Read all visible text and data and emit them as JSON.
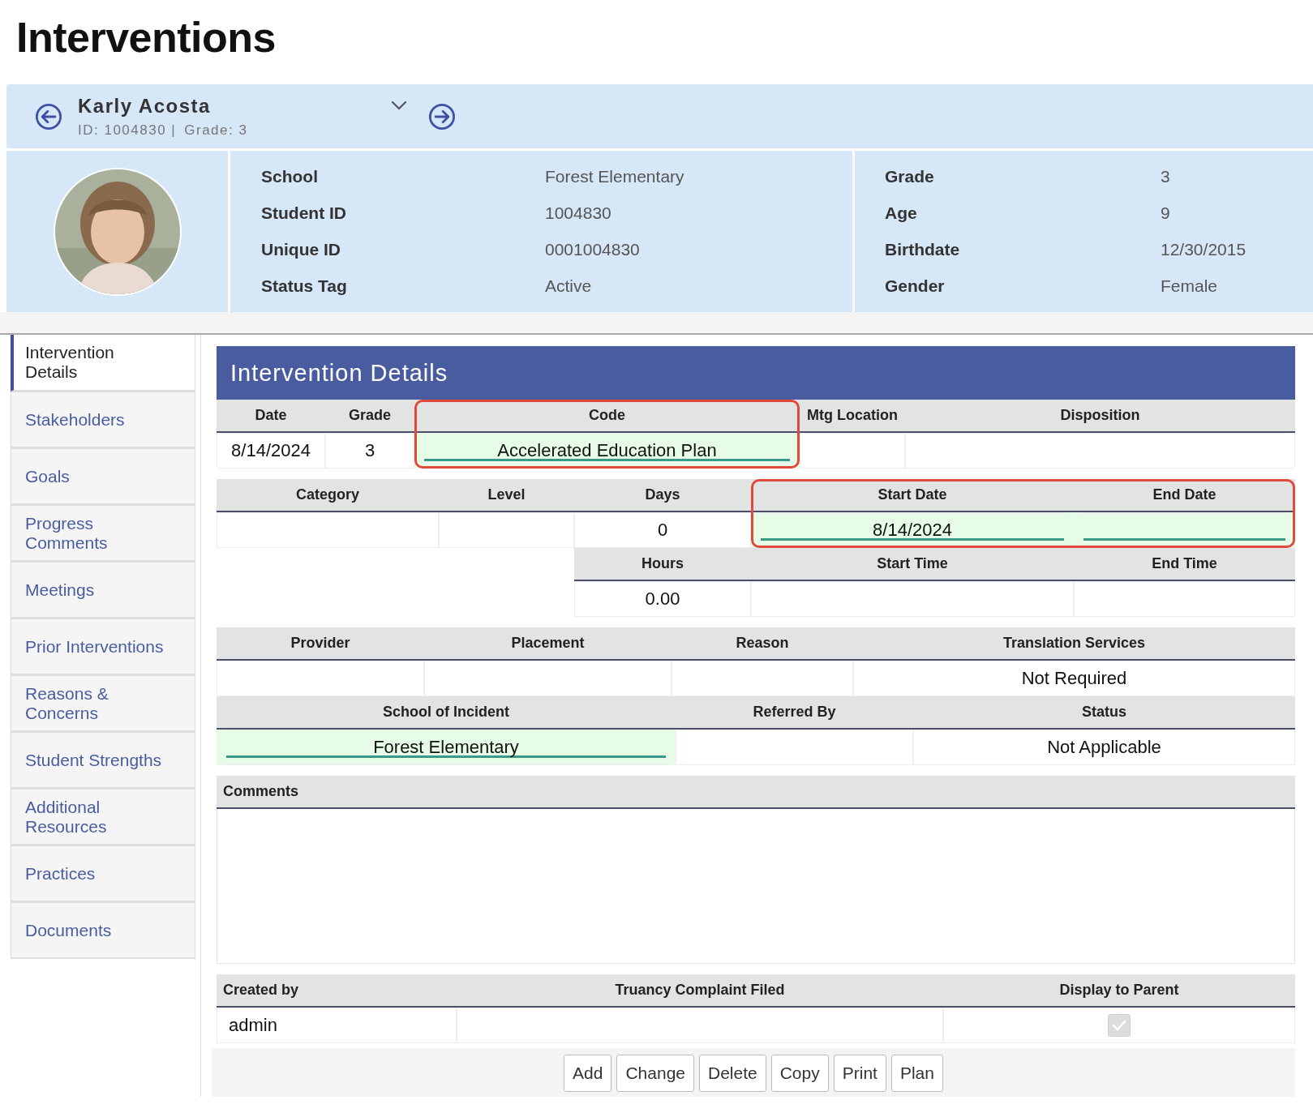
{
  "page_title": "Interventions",
  "student": {
    "name": "Karly Acosta",
    "id_label": "ID: 1004830 |",
    "grade_label": "Grade: 3"
  },
  "profile": {
    "left": [
      {
        "label": "School",
        "value": "Forest Elementary"
      },
      {
        "label": "Student ID",
        "value": "1004830"
      },
      {
        "label": "Unique ID",
        "value": "0001004830"
      },
      {
        "label": "Status Tag",
        "value": "Active"
      }
    ],
    "right": [
      {
        "label": "Grade",
        "value": "3"
      },
      {
        "label": "Age",
        "value": "9"
      },
      {
        "label": "Birthdate",
        "value": "12/30/2015"
      },
      {
        "label": "Gender",
        "value": "Female"
      }
    ]
  },
  "sidebar": {
    "items": [
      {
        "label": "Intervention Details",
        "selected": true
      },
      {
        "label": "Stakeholders",
        "selected": false
      },
      {
        "label": "Goals",
        "selected": false
      },
      {
        "label": "Progress Comments",
        "selected": false
      },
      {
        "label": "Meetings",
        "selected": false
      },
      {
        "label": "Prior Interventions",
        "selected": false
      },
      {
        "label": "Reasons & Concerns",
        "selected": false
      },
      {
        "label": "Student Strengths",
        "selected": false
      },
      {
        "label": "Additional Resources",
        "selected": false
      },
      {
        "label": "Practices",
        "selected": false
      },
      {
        "label": "Documents",
        "selected": false
      }
    ]
  },
  "panel": {
    "title": "Intervention Details",
    "groups": [
      {
        "columns": [
          {
            "label": "Date",
            "value": "8/14/2024",
            "required": false,
            "highlighted": false
          },
          {
            "label": "Grade",
            "value": "3",
            "required": false,
            "highlighted": false
          },
          {
            "label": "Code",
            "value": "Accelerated Education Plan",
            "required": true,
            "highlighted": true
          },
          {
            "label": "Mtg Location",
            "required": false,
            "highlighted": false
          },
          {
            "label": "Disposition",
            "required": false,
            "highlighted": false
          }
        ]
      },
      {
        "columns": [
          {
            "label": "Category",
            "required": false,
            "highlighted": false
          },
          {
            "label": "Level",
            "required": false,
            "highlighted": false
          },
          {
            "label": "Days",
            "value": "0",
            "required": false,
            "highlighted": false
          },
          {
            "label": "Start Date",
            "value": "8/14/2024",
            "required": true,
            "highlighted": true
          },
          {
            "label": "End Date",
            "required": true,
            "highlighted": true
          }
        ],
        "sub_columns": [
          {
            "label": "Hours",
            "value": "0.00",
            "required": false,
            "highlighted": false
          },
          {
            "label": "Start Time",
            "required": false,
            "highlighted": false
          },
          {
            "label": "End Time",
            "required": false,
            "highlighted": false
          }
        ]
      },
      {
        "columns": [
          {
            "label": "Provider",
            "required": false,
            "highlighted": false
          },
          {
            "label": "Placement",
            "required": false,
            "highlighted": false
          },
          {
            "label": "Reason",
            "required": false,
            "highlighted": false
          },
          {
            "label": "Translation Services",
            "value": "Not Required",
            "required": false,
            "highlighted": false
          }
        ]
      },
      {
        "columns": [
          {
            "label": "School of Incident",
            "value": "Forest Elementary",
            "required": true,
            "highlighted": false
          },
          {
            "label": "Referred By",
            "required": false,
            "highlighted": false
          },
          {
            "label": "Status",
            "value": "Not Applicable",
            "required": false,
            "highlighted": false
          }
        ]
      }
    ],
    "comments": {
      "label": "Comments"
    },
    "footer": [
      {
        "kind": "text",
        "label": "Created by",
        "value": "admin"
      },
      {
        "kind": "text",
        "label": "Truancy Complaint Filed"
      },
      {
        "kind": "checkbox",
        "label": "Display to Parent",
        "checked": true,
        "disabled": true
      }
    ],
    "buttons": [
      "Add",
      "Change",
      "Delete",
      "Copy",
      "Print",
      "Plan"
    ]
  }
}
